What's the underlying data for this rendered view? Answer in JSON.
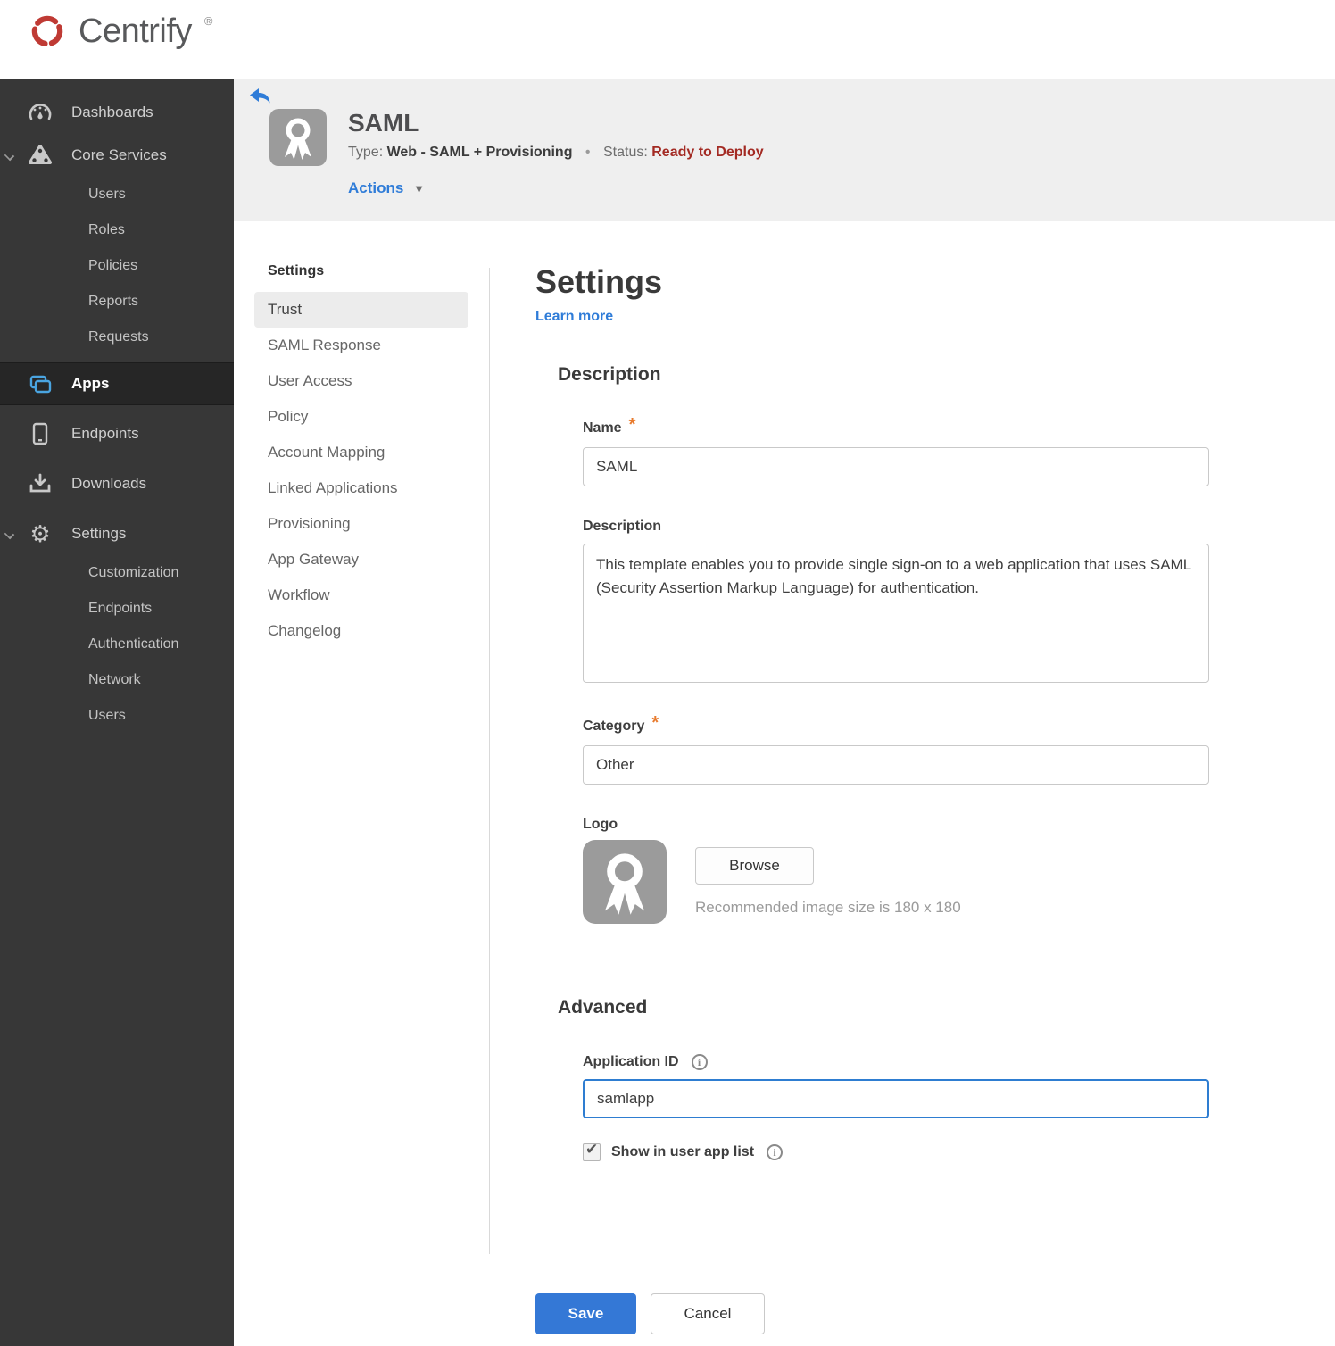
{
  "brand": {
    "name": "Centrify",
    "registered_mark": "®"
  },
  "colors": {
    "accent_blue": "#2f7cd8",
    "save_blue": "#3478d6",
    "status_red": "#a32a23",
    "asterisk_orange": "#e87b2e",
    "sidebar_bg": "#373737",
    "sidebar_selected_bg": "#262626",
    "header_band_bg": "#efefef"
  },
  "icons": {
    "gear_glyph": "⚙",
    "dropdown_arrow_glyph": "▼",
    "checkbox_check_glyph": "✔",
    "asterisk_glyph": "*",
    "dot_separator": "•"
  },
  "sidebar": {
    "items": [
      {
        "label": "Dashboards",
        "icon": "gauge-icon"
      },
      {
        "label": "Core Services",
        "icon": "core-services-icon",
        "expanded": true,
        "children": [
          "Users",
          "Roles",
          "Policies",
          "Reports",
          "Requests"
        ]
      },
      {
        "label": "Apps",
        "icon": "apps-icon",
        "selected": true
      },
      {
        "label": "Endpoints",
        "icon": "mobile-icon"
      },
      {
        "label": "Downloads",
        "icon": "download-icon"
      },
      {
        "label": "Settings",
        "icon": "gear-icon",
        "expanded": true,
        "children": [
          "Customization",
          "Endpoints",
          "Authentication",
          "Network",
          "Users"
        ]
      }
    ]
  },
  "app_header": {
    "title": "SAML",
    "type_label": "Type:",
    "type_value": "Web - SAML + Provisioning",
    "status_label": "Status:",
    "status_value": "Ready to Deploy",
    "actions_label": "Actions"
  },
  "subnav": {
    "header": "Settings",
    "selected_item": "Trust",
    "items": [
      "Trust",
      "SAML Response",
      "User Access",
      "Policy",
      "Account Mapping",
      "Linked Applications",
      "Provisioning",
      "App Gateway",
      "Workflow",
      "Changelog"
    ]
  },
  "main": {
    "title": "Settings",
    "learn_more": "Learn more",
    "description_section": {
      "heading": "Description",
      "name_label": "Name",
      "name_value": "SAML",
      "description_label": "Description",
      "description_value": "This template enables you to provide single sign-on to a web application that uses SAML (Security Assertion Markup Language) for authentication.",
      "category_label": "Category",
      "category_value": "Other",
      "logo_label": "Logo",
      "browse_label": "Browse",
      "logo_hint": "Recommended image size is 180 x 180"
    },
    "advanced_section": {
      "heading": "Advanced",
      "application_id_label": "Application ID",
      "application_id_value": "samlapp",
      "show_in_user_app_list_label": "Show in user app list",
      "checkbox_checked": "checked"
    },
    "save_label": "Save",
    "cancel_label": "Cancel"
  }
}
